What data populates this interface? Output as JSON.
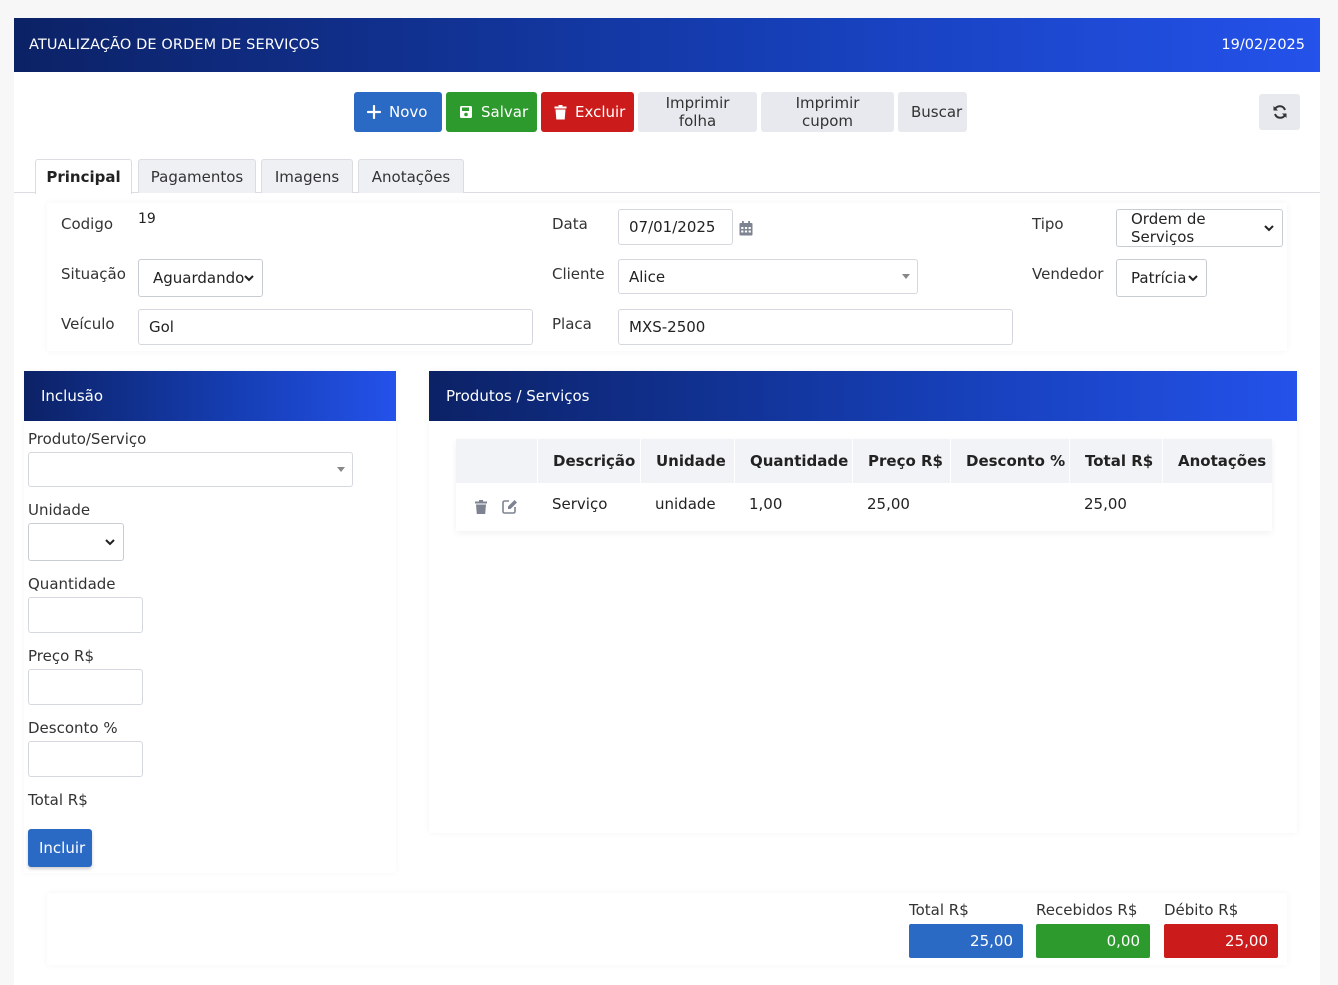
{
  "header": {
    "title": "ATUALIZAÇÃO DE ORDEM DE SERVIÇOS",
    "date": "19/02/2025"
  },
  "toolbar": {
    "novo": "Novo",
    "salvar": "Salvar",
    "excluir": "Excluir",
    "imprimir_folha": "Imprimir folha",
    "imprimir_cupom": "Imprimir cupom",
    "buscar": "Buscar"
  },
  "tabs": [
    "Principal",
    "Pagamentos",
    "Imagens",
    "Anotações"
  ],
  "form": {
    "codigo_label": "Codigo",
    "codigo_value": "19",
    "data_label": "Data",
    "data_value": "07/01/2025",
    "tipo_label": "Tipo",
    "tipo_value": "Ordem de Serviços",
    "situacao_label": "Situação",
    "situacao_value": "Aguardando",
    "cliente_label": "Cliente",
    "cliente_value": "Alice",
    "vendedor_label": "Vendedor",
    "vendedor_value": "Patrícia",
    "veiculo_label": "Veículo",
    "veiculo_value": "Gol",
    "placa_label": "Placa",
    "placa_value": "MXS-2500"
  },
  "inclusao": {
    "title": "Inclusão",
    "produto_label": "Produto/Serviço",
    "unidade_label": "Unidade",
    "quantidade_label": "Quantidade",
    "preco_label": "Preço R$",
    "desconto_label": "Desconto %",
    "total_label": "Total R$",
    "incluir": "Incluir"
  },
  "produtos": {
    "title": "Produtos / Serviços",
    "columns": [
      "Descrição",
      "Unidade",
      "Quantidade",
      "Preço R$",
      "Desconto %",
      "Total R$",
      "Anotações"
    ],
    "rows": [
      {
        "descricao": "Serviço",
        "unidade": "unidade",
        "quantidade": "1,00",
        "preco": "25,00",
        "desconto": "",
        "total": "25,00",
        "anotacoes": ""
      }
    ]
  },
  "totals": {
    "total_label": "Total R$",
    "total_value": "25,00",
    "recebidos_label": "Recebidos R$",
    "recebidos_value": "0,00",
    "debito_label": "Débito R$",
    "debito_value": "25,00"
  },
  "colors": {
    "primary": "#2a6ac4",
    "success": "#2c9a2c",
    "danger": "#cc1b1b",
    "header_dark": "#0c2266",
    "header_light": "#2452ea"
  }
}
